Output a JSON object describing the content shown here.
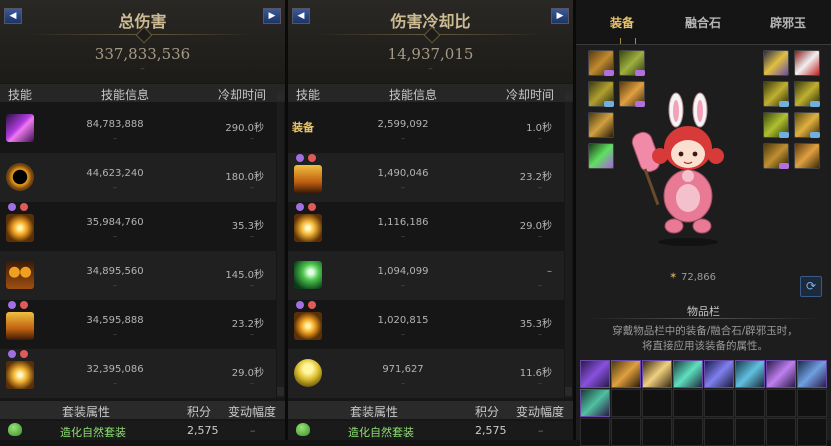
{
  "damage_panel": {
    "title": "总伤害",
    "total": "337,833,536",
    "total_sub": "–",
    "nav_left": "◀",
    "nav_right": "▶",
    "col_skill": "技能",
    "col_info": "技能信息",
    "col_cd": "冷却时间",
    "rows": [
      {
        "icon": "purple-lightning-skill-icon",
        "damage": "84,783,888",
        "cooldown": "290.0秒",
        "sub": "–"
      },
      {
        "icon": "gold-ring-skill-icon",
        "damage": "44,623,240",
        "cooldown": "180.0秒",
        "sub": "–"
      },
      {
        "icon": "sun-eye-skill-icon",
        "damage": "35,984,760",
        "cooldown": "35.3秒",
        "sub": "–"
      },
      {
        "icon": "fire-totem-skill-icon",
        "damage": "34,895,560",
        "cooldown": "145.0秒",
        "sub": "–"
      },
      {
        "icon": "flame-face-skill-icon",
        "damage": "34,595,888",
        "cooldown": "23.2秒",
        "sub": "–"
      },
      {
        "icon": "radiant-eye-skill-icon",
        "damage": "32,395,086",
        "cooldown": "29.0秒",
        "sub": "–"
      }
    ],
    "set_header": {
      "attr": "套装属性",
      "score": "积分",
      "change": "变动幅度"
    },
    "set_row": {
      "icon": "nature-tree-icon",
      "name": "造化自然套装",
      "score": "2,575",
      "change": "–"
    }
  },
  "cooldown_panel": {
    "title": "伤害冷却比",
    "total": "14,937,015",
    "total_sub": "–",
    "nav_left": "◀",
    "nav_right": "▶",
    "col_skill": "技能",
    "col_info": "技能信息",
    "col_cd": "冷却时间",
    "rows": [
      {
        "icon": "",
        "label": "装备",
        "damage": "2,599,092",
        "cooldown": "1.0秒",
        "sub": "–"
      },
      {
        "icon": "flame-face-skill-icon",
        "damage": "1,490,046",
        "cooldown": "23.2秒",
        "sub": "–"
      },
      {
        "icon": "radiant-eye-skill-icon",
        "damage": "1,116,186",
        "cooldown": "29.0秒",
        "sub": "–"
      },
      {
        "icon": "green-wind-skill-icon",
        "damage": "1,094,099",
        "cooldown": "–",
        "sub": "–"
      },
      {
        "icon": "sun-eye-skill-icon",
        "damage": "1,020,815",
        "cooldown": "35.3秒",
        "sub": "–"
      },
      {
        "icon": "thunder-cloud-skill-icon",
        "damage": "971,627",
        "cooldown": "11.6秒",
        "sub": "–"
      }
    ],
    "set_header": {
      "attr": "套装属性",
      "score": "积分",
      "change": "变动幅度"
    },
    "set_row": {
      "icon": "nature-tree-icon",
      "name": "造化自然套装",
      "score": "2,575",
      "change": "–"
    }
  },
  "equipment_panel": {
    "tabs": [
      "装备",
      "融合石",
      "辟邪玉"
    ],
    "active_tab": "装备",
    "score": "72,866",
    "score_icon": "✶",
    "refresh_icon": "⟳",
    "bag_title": "物品栏",
    "bag_desc_line1": "穿戴物品栏中的装备/融合石/辟邪玉时，",
    "bag_desc_line2": "将直接应用该装备的属性。",
    "colors": {
      "gold": "#e6c46a",
      "purple_border": "#6a4aa8",
      "bunny_pink": "#e87a95",
      "hair_red": "#d83a3a"
    }
  }
}
